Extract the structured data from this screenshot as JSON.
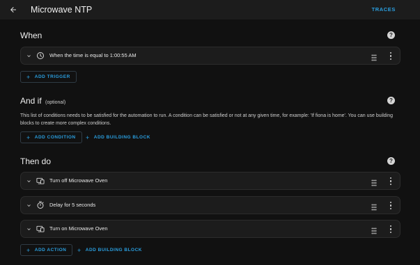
{
  "header": {
    "title": "Microwave NTP",
    "traces_label": "TRACES"
  },
  "when": {
    "title": "When",
    "triggers": [
      {
        "label": "When the time is equal to 1:00:55 AM",
        "icon": "clock-icon"
      }
    ],
    "add_trigger_label": "ADD TRIGGER"
  },
  "and_if": {
    "title": "And if",
    "optional_label": "(optional)",
    "description": "This list of conditions needs to be satisfied for the automation to run. A condition can be satisfied or not at any given time, for example: 'If fiona is home'. You can use building blocks to create more complex conditions.",
    "add_condition_label": "ADD CONDITION",
    "add_building_block_label": "ADD BUILDING BLOCK"
  },
  "then_do": {
    "title": "Then do",
    "actions": [
      {
        "label": "Turn off Microwave Oven",
        "icon": "device-icon"
      },
      {
        "label": "Delay for 5 seconds",
        "icon": "timer-icon"
      },
      {
        "label": "Turn on Microwave Oven",
        "icon": "device-icon"
      }
    ],
    "add_action_label": "ADD ACTION",
    "add_building_block_label": "ADD BUILDING BLOCK"
  },
  "colors": {
    "accent": "#2a9fe0",
    "background": "#111111",
    "card": "#1c1c1c"
  }
}
